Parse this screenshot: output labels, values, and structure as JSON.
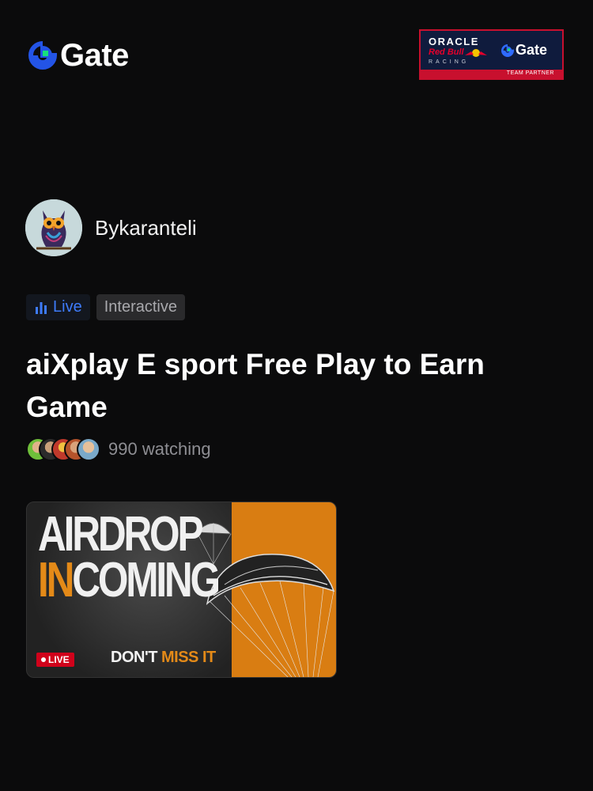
{
  "brand": {
    "logo_text": "Gate",
    "accent": "#2354e6",
    "accent_green": "#17e07c"
  },
  "partner_badge": {
    "line1": "ORACLE",
    "line2": "Red Bull",
    "line3": "RACING",
    "gate_text": "Gate",
    "strip_text": "TEAM PARTNER"
  },
  "author": {
    "name": "Bykaranteli",
    "avatar_icon": "owl-avatar"
  },
  "tags": {
    "live": "Live",
    "live_color": "#3e7bfa",
    "live_icon": "bar-chart-icon",
    "interactive": "Interactive"
  },
  "stream": {
    "title": "aiXplay E sport Free Play to Earn Game",
    "watching": "990 watching"
  },
  "banner": {
    "line1": "AIRDROP",
    "line2_highlight": "IN",
    "line2_rest": "COMING",
    "live_badge": "LIVE",
    "cta_prefix": "DON'T ",
    "cta_highlight": "MISS IT",
    "orange": "#d97d12"
  }
}
